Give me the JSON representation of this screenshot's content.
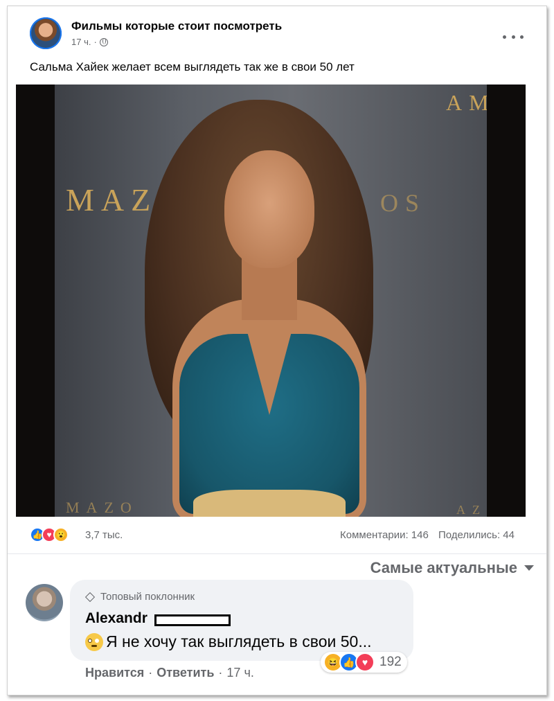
{
  "post": {
    "page_name": "Фильмы которые стоит посмотреть",
    "time": "17 ч.",
    "separator": "·",
    "text": "Сальма Хайек желает всем выглядеть так же в свои 50 лет"
  },
  "media": {
    "sign_left": "MAZO",
    "sign_right_fragment": "OS",
    "sign_top_right": "AM",
    "sign_bottom_left": "MAZO",
    "sign_bottom_right": "AZO"
  },
  "reactions": {
    "icons": [
      "like-icon",
      "love-icon",
      "wow-icon"
    ],
    "count": "3,7 тыс.",
    "comments": "Комментарии: 146",
    "shares": "Поделились: 44"
  },
  "sort": {
    "label": "Самые актуальные"
  },
  "comment": {
    "badge": "Топовый поклонник",
    "author": "Alexandr",
    "text": "Я не хочу так выглядеть в свои 50...",
    "emoji": "flushed-face-icon",
    "reaction_icons": [
      "haha-icon",
      "like-icon",
      "love-icon"
    ],
    "reaction_count": "192",
    "like_label": "Нравится",
    "reply_label": "Ответить",
    "time": "17 ч.",
    "separator": "·"
  },
  "colors": {
    "accent": "#1877f2",
    "love": "#f33e58",
    "secondary_text": "#65676b",
    "bubble": "#f0f2f5"
  }
}
